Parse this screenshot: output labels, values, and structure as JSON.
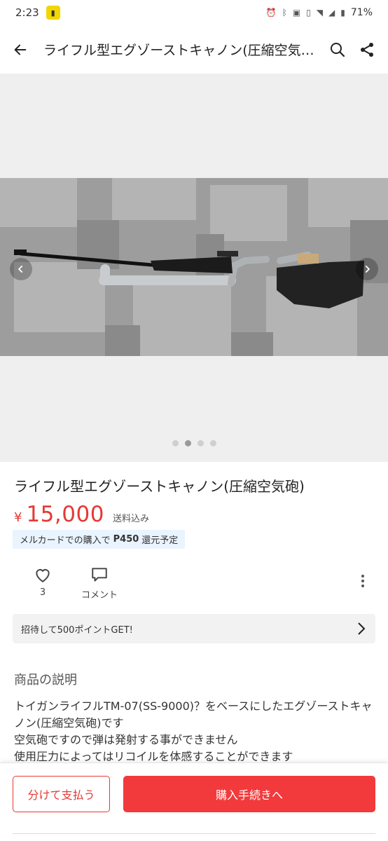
{
  "status_bar": {
    "time": "2:23",
    "battery": "71%",
    "icons": [
      "alarm-icon",
      "bluetooth-icon",
      "nfc-icon",
      "vibrate-icon",
      "wifi-icon",
      "signal-icon",
      "battery-icon"
    ]
  },
  "header": {
    "title": "ライフル型エグゾーストキャノン(圧縮空気…",
    "back_icon": "back-arrow-icon",
    "search_icon": "search-icon",
    "share_icon": "share-icon"
  },
  "gallery": {
    "page_count": 4,
    "active_index": 1
  },
  "product": {
    "title": "ライフル型エグゾーストキャノン(圧縮空気砲)",
    "price_symbol": "¥",
    "price": "15,000",
    "shipping": "送料込み",
    "points": {
      "prefix": "メルカードでの購入で",
      "points": "P450",
      "suffix": "還元予定"
    },
    "likes": {
      "count": "3"
    },
    "comment_label": "コメント"
  },
  "invite": {
    "label": "招待して500ポイントGET!"
  },
  "description": {
    "heading": "商品の説明",
    "lines": [
      "トイガンライフルTM-07(SS-9000)？をベースにしたエグゾーストキャノン(圧縮空気砲)です",
      "空気砲ですので弾は発射する事ができません",
      "使用圧力によってはリコイルを体感することができます"
    ]
  },
  "bottom_bar": {
    "split_label": "分けて支払う",
    "buy_label": "購入手続きへ"
  },
  "colors": {
    "accent": "#f23a3c",
    "price": "#e53935",
    "points_bg": "#e9f4ff"
  }
}
